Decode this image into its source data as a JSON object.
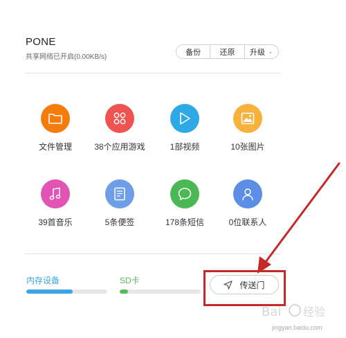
{
  "header": {
    "device_name": "PONE",
    "share_status": "共享网络已开启(0.00KB/s)",
    "buttons": {
      "backup": "备份",
      "restore": "还原",
      "upgrade": "升级"
    }
  },
  "tiles": [
    {
      "label": "文件管理",
      "icon": "folder-icon",
      "color": "#f57c0b"
    },
    {
      "label": "38个应用游戏",
      "icon": "apps-grid-icon",
      "color": "#ef5350"
    },
    {
      "label": "1部视频",
      "icon": "play-icon",
      "color": "#2fa8e6"
    },
    {
      "label": "10张图片",
      "icon": "picture-icon",
      "color": "#f7b13d"
    },
    {
      "label": "39首音乐",
      "icon": "music-note-icon",
      "color": "#e254b4"
    },
    {
      "label": "5条便签",
      "icon": "note-icon",
      "color": "#6f9ee8"
    },
    {
      "label": "178条短信",
      "icon": "message-bubble-icon",
      "color": "#4cb853"
    },
    {
      "label": "0位联系人",
      "icon": "contact-person-icon",
      "color": "#5d8ee6"
    }
  ],
  "storage": {
    "internal": {
      "label": "内存设备",
      "color": "#3aa6e3",
      "fill_fraction": 0.57
    },
    "sd": {
      "label": "SD卡",
      "color": "#5cb85c",
      "fill_fraction": 0.1
    }
  },
  "send_button": {
    "label": "传送门",
    "icon": "paper-plane-icon"
  },
  "watermark": {
    "text": "jingyan.baidu.com"
  }
}
